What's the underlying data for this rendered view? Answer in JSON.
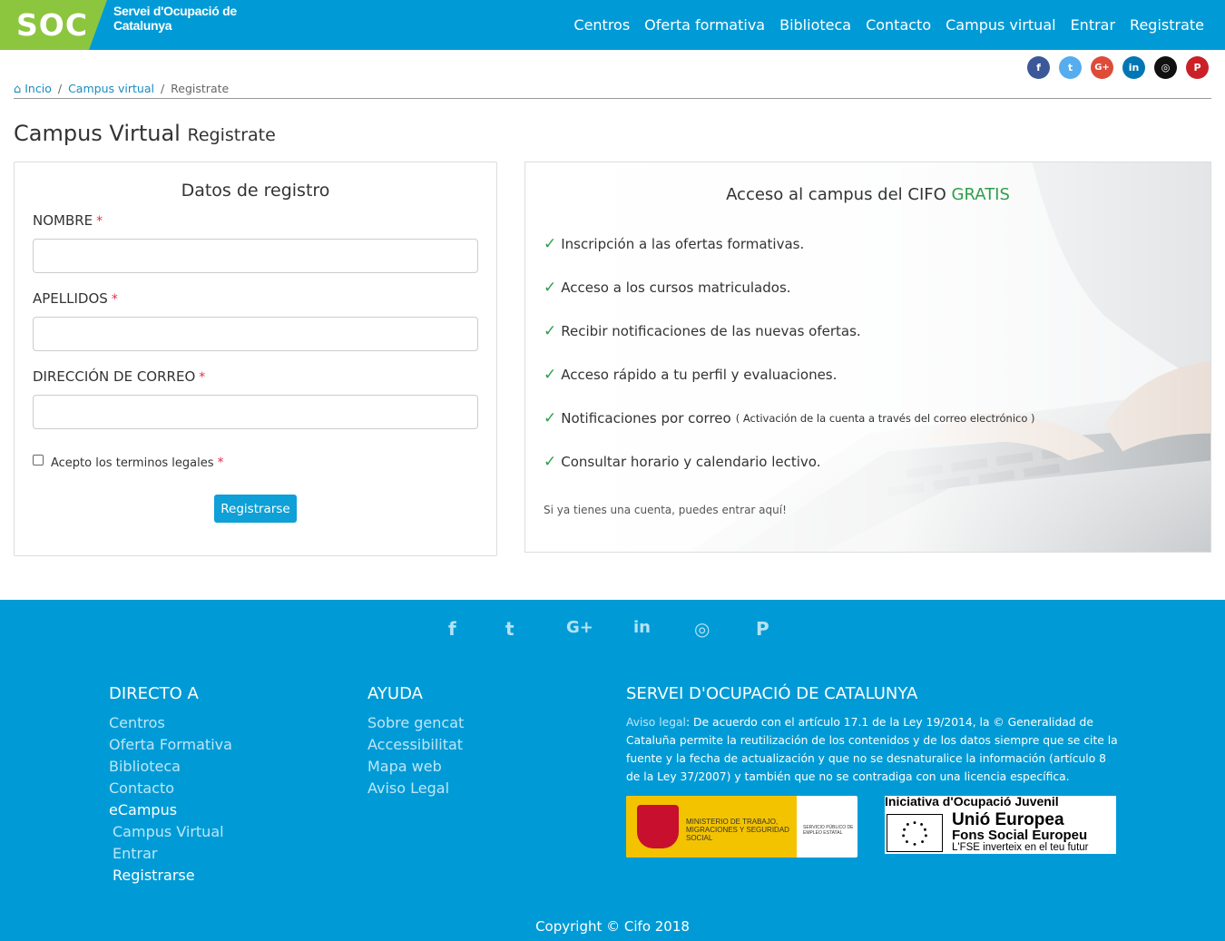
{
  "header": {
    "logo_short": "SOC",
    "logo_text": "Servei d'Ocupació de Catalunya",
    "nav": [
      "Centros",
      "Oferta formativa",
      "Biblioteca",
      "Contacto",
      "Campus virtual",
      "Entrar",
      "Registrate"
    ]
  },
  "social_top": [
    {
      "name": "facebook-icon",
      "glyph": "f",
      "color": "#3b5998"
    },
    {
      "name": "twitter-icon",
      "glyph": "t",
      "color": "#55acee"
    },
    {
      "name": "google-plus-icon",
      "glyph": "G+",
      "color": "#dd4b39"
    },
    {
      "name": "linkedin-icon",
      "glyph": "in",
      "color": "#0077b5"
    },
    {
      "name": "instagram-icon",
      "glyph": "◎",
      "color": "#111111"
    },
    {
      "name": "pinterest-icon",
      "glyph": "P",
      "color": "#cb2027"
    }
  ],
  "breadcrumb": {
    "home": "Incio",
    "section": "Campus virtual",
    "current": "Registrate"
  },
  "page_title": {
    "main": "Campus Virtual",
    "sub": "Registrate"
  },
  "form": {
    "title": "Datos de registro",
    "name_label": "NOMBRE",
    "surname_label": "APELLIDOS",
    "email_label": "DIRECCIÓN DE CORREO",
    "required_mark": "*",
    "name_value": "",
    "surname_value": "",
    "email_value": "",
    "terms_label": "Acepto los terminos legales",
    "submit_label": "Registrarse"
  },
  "info": {
    "title_prefix": "Acceso al campus del CIFO",
    "title_highlight": "GRATIS",
    "features": [
      {
        "text": "Inscripción a las ofertas formativas.",
        "sub": ""
      },
      {
        "text": "Acceso a los cursos matriculados.",
        "sub": ""
      },
      {
        "text": "Recibir notificaciones de las nuevas ofertas.",
        "sub": ""
      },
      {
        "text": "Acceso rápido a tu perfil y evaluaciones.",
        "sub": ""
      },
      {
        "text": "Notificaciones por correo",
        "sub": "( Activación de la cuenta a través del correo electrónico )"
      },
      {
        "text": "Consultar horario y calendario lectivo.",
        "sub": ""
      }
    ],
    "note": "Si ya tienes una cuenta, puedes entrar aquí!"
  },
  "footer": {
    "social": [
      "f",
      "t",
      "G+",
      "in",
      "◎",
      "P"
    ],
    "col1": {
      "title": "DIRECTO A",
      "links": [
        "Centros",
        "Oferta Formativa",
        "Biblioteca",
        "Contacto",
        "eCampus",
        "Campus Virtual",
        "Entrar",
        "Registrarse"
      ]
    },
    "col2": {
      "title": "AYUDA",
      "links": [
        "Sobre gencat",
        "Accessibilitat",
        "Mapa web",
        "Aviso Legal"
      ]
    },
    "col3": {
      "title": "SERVEI D'OCUPACIÓ DE CATALUNYA",
      "aviso_link": "Aviso legal",
      "legal_text": ": De acuerdo con el artículo 17.1 de la Ley 19/2014, la © Generalidad de Cataluña permite la reutilización de los contenidos y de los datos siempre que se cite la fuente y la fecha de actualización y que no se desnaturalice la información (artículo 8 de la Ley 37/2007) y también que no se contradiga con una licencia específica."
    },
    "logo_ministerio": "MINISTERIO DE TRABAJO, MIGRACIONES Y SEGURIDAD SOCIAL",
    "logo_sepe": "SERVICIO PÚBLICO DE EMPLEO ESTATAL",
    "logo_eu": {
      "line1": "Iniciativa d'Ocupació Juvenil",
      "line2": "Unió Europea",
      "line3": "Fons Social Europeu",
      "line4": "L'FSE inverteix en el teu futur"
    },
    "copyright": "Copyright © Cifo 2018"
  }
}
